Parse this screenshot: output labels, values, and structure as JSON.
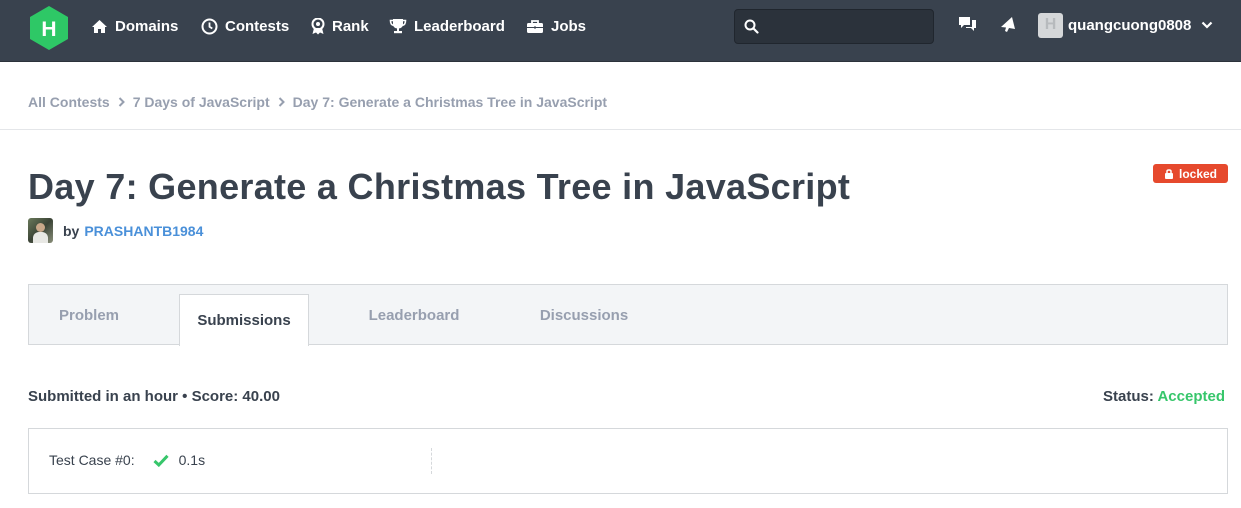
{
  "nav": {
    "logo_letter": "H",
    "items": [
      {
        "label": "Domains",
        "icon": "home-icon"
      },
      {
        "label": "Contests",
        "icon": "clock-icon"
      },
      {
        "label": "Rank",
        "icon": "ribbon-icon"
      },
      {
        "label": "Leaderboard",
        "icon": "trophy-icon"
      },
      {
        "label": "Jobs",
        "icon": "briefcase-icon"
      }
    ],
    "search_placeholder": "",
    "username": "quangcuong0808"
  },
  "breadcrumb": [
    "All Contests",
    "7 Days of JavaScript",
    "Day 7: Generate a Christmas Tree in JavaScript"
  ],
  "challenge": {
    "title": "Day 7: Generate a Christmas Tree in JavaScript",
    "locked_label": "locked",
    "by_label": "by",
    "author": "PRASHANTB1984"
  },
  "tabs": [
    {
      "label": "Problem",
      "active": false
    },
    {
      "label": "Submissions",
      "active": true
    },
    {
      "label": "Leaderboard",
      "active": false
    },
    {
      "label": "Discussions",
      "active": false
    }
  ],
  "submission": {
    "summary": "Submitted in an hour • Score: 40.00",
    "status_label": "Status:",
    "status_value": "Accepted",
    "test_cases": [
      {
        "label": "Test Case #0:",
        "time": "0.1s",
        "passed": true
      }
    ]
  },
  "colors": {
    "nav_bg": "#39424e",
    "logo_green": "#2ec866",
    "accent_blue": "#4a90d9",
    "locked_red": "#e6492d",
    "accepted_green": "#37c66b"
  }
}
